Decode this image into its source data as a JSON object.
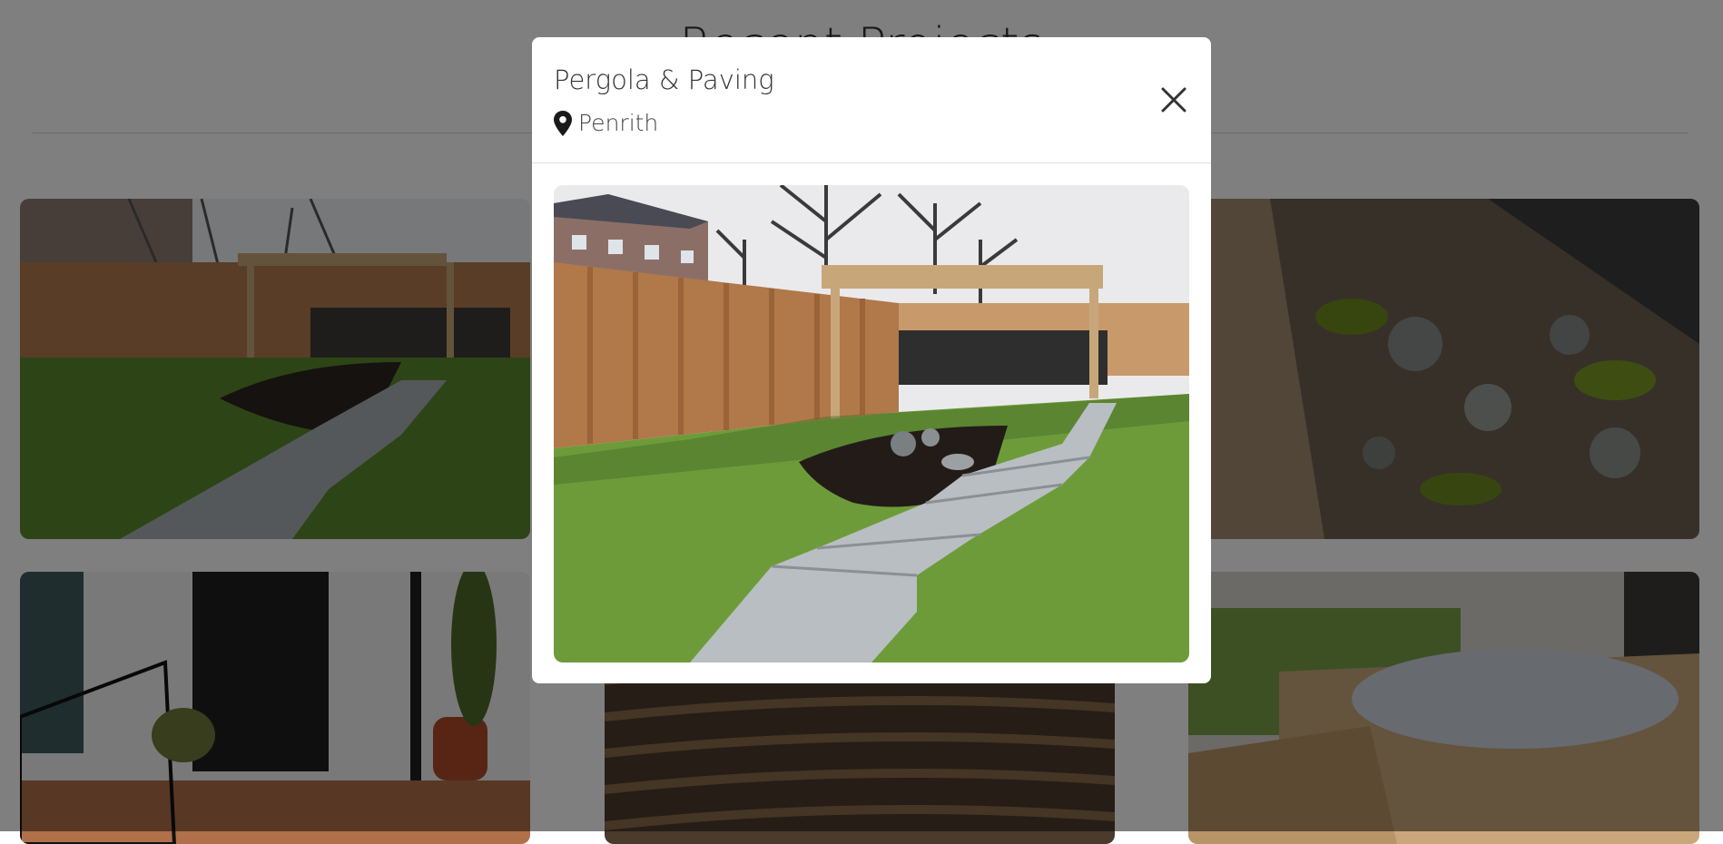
{
  "page": {
    "title": "Recent Projects"
  },
  "gallery": {
    "items": [
      {
        "image": "garden-pergola-paving-photo"
      },
      {
        "image": "garden-photo"
      },
      {
        "image": "rockery-cobbles-photo"
      },
      {
        "image": "front-patio-railings-photo"
      },
      {
        "image": "woven-willow-fence-photo"
      },
      {
        "image": "decking-hot-tub-photo"
      }
    ]
  },
  "modal": {
    "title": "Pergola & Paving",
    "location": "Penrith",
    "location_icon": "map-pin-icon",
    "close_icon": "close-icon",
    "image": "garden-pergola-paving-photo"
  },
  "colors": {
    "overlay": "#000000",
    "modal_background": "#ffffff",
    "title_text": "#333333"
  }
}
